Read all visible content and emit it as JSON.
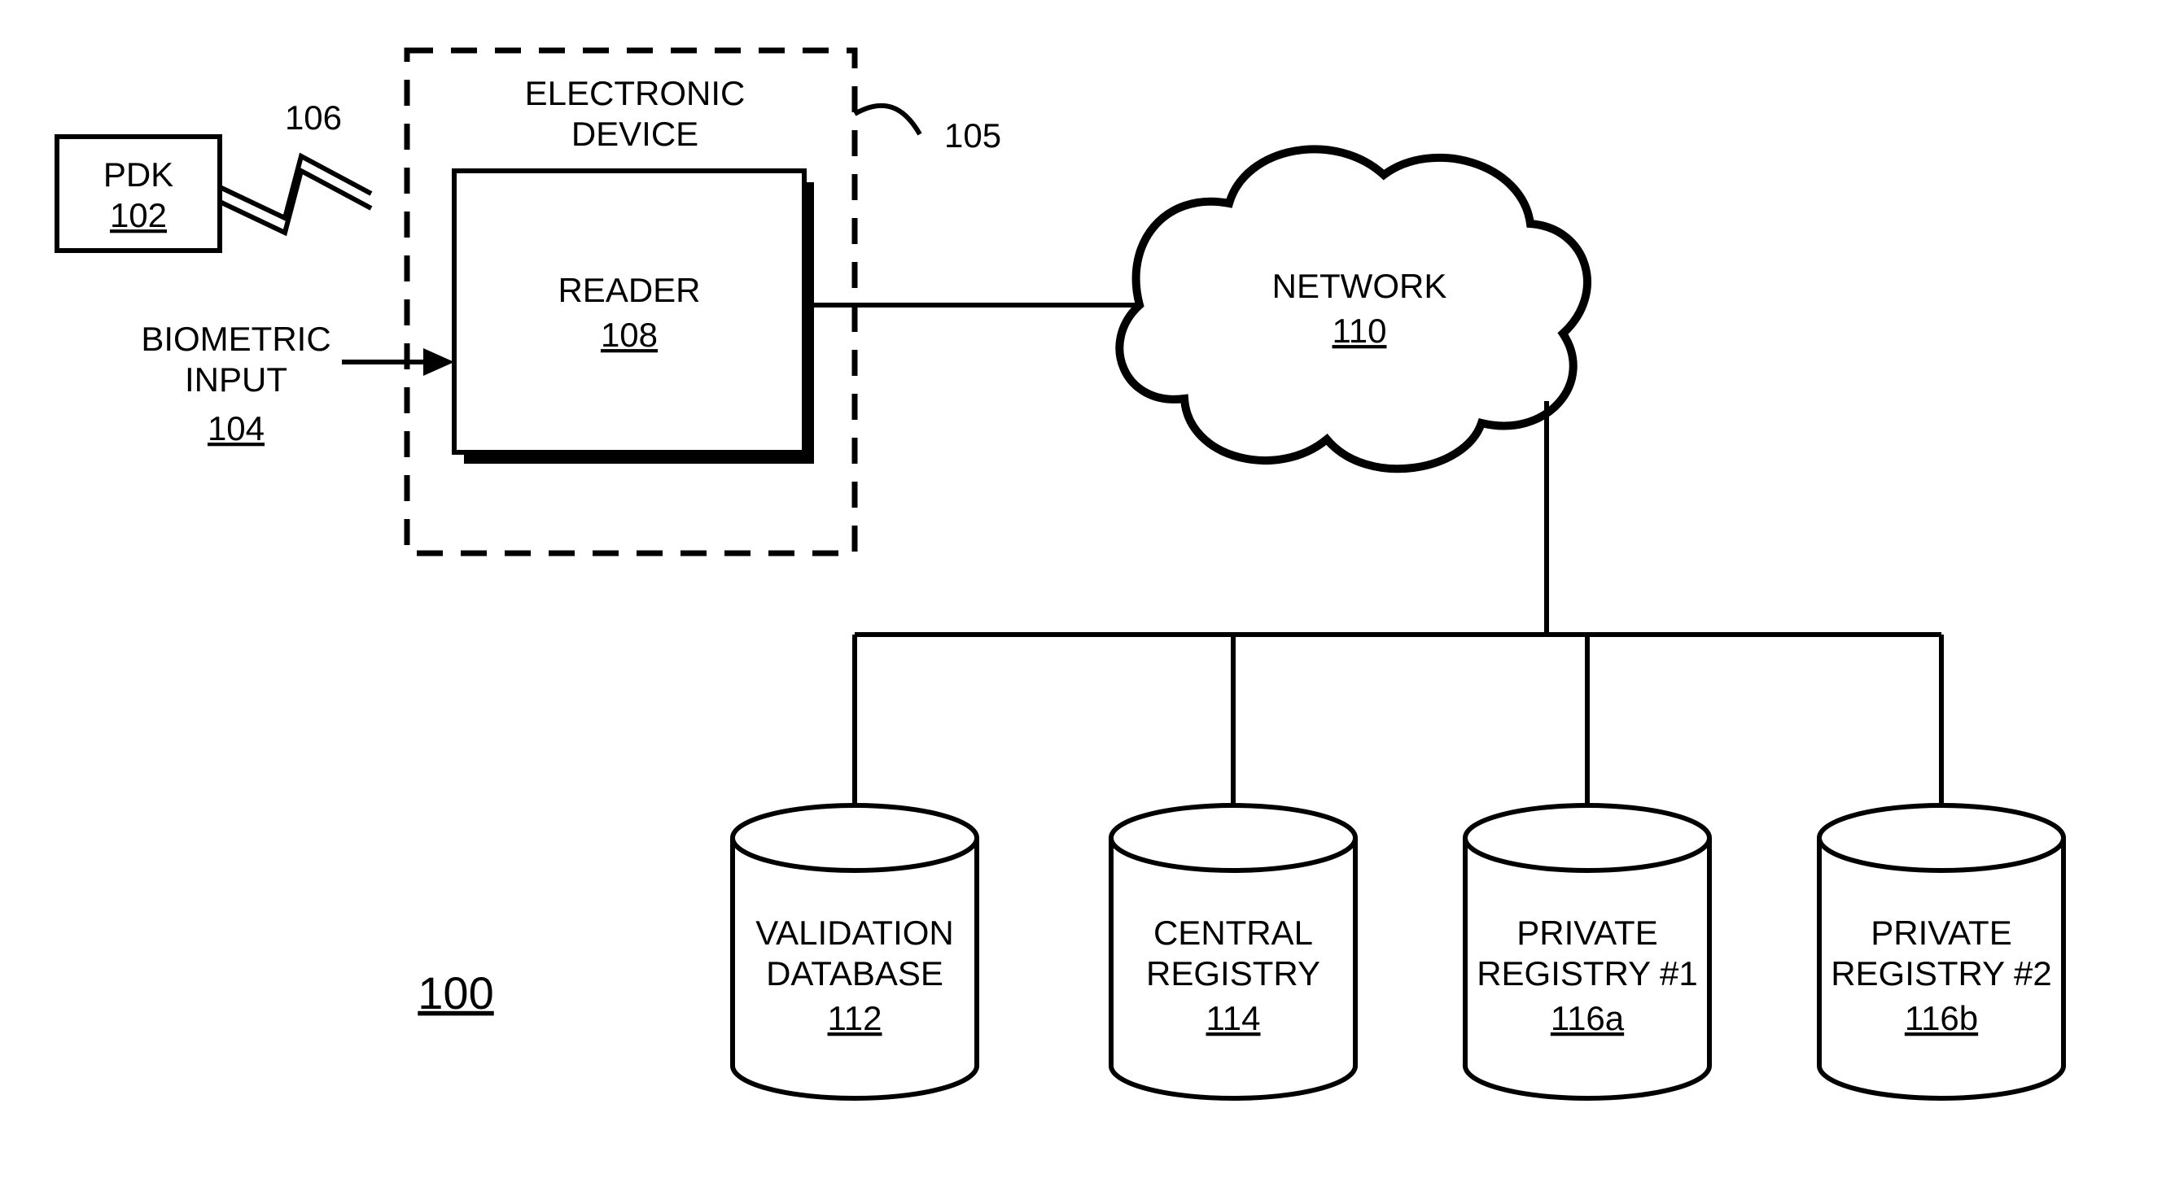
{
  "figure_ref": "100",
  "pdk": {
    "label": "PDK",
    "ref": "102"
  },
  "wireless_link_ref": "106",
  "biometric": {
    "line1": "BIOMETRIC",
    "line2": "INPUT",
    "ref": "104"
  },
  "electronic_device": {
    "line1": "ELECTRONIC",
    "line2": "DEVICE",
    "ref": "105"
  },
  "reader": {
    "label": "READER",
    "ref": "108"
  },
  "network": {
    "label": "NETWORK",
    "ref": "110"
  },
  "databases": {
    "validation": {
      "line1": "VALIDATION",
      "line2": "DATABASE",
      "ref": "112"
    },
    "central": {
      "line1": "CENTRAL",
      "line2": "REGISTRY",
      "ref": "114"
    },
    "private1": {
      "line1": "PRIVATE",
      "line2": "REGISTRY #1",
      "ref": "116a"
    },
    "private2": {
      "line1": "PRIVATE",
      "line2": "REGISTRY #2",
      "ref": "116b"
    }
  }
}
